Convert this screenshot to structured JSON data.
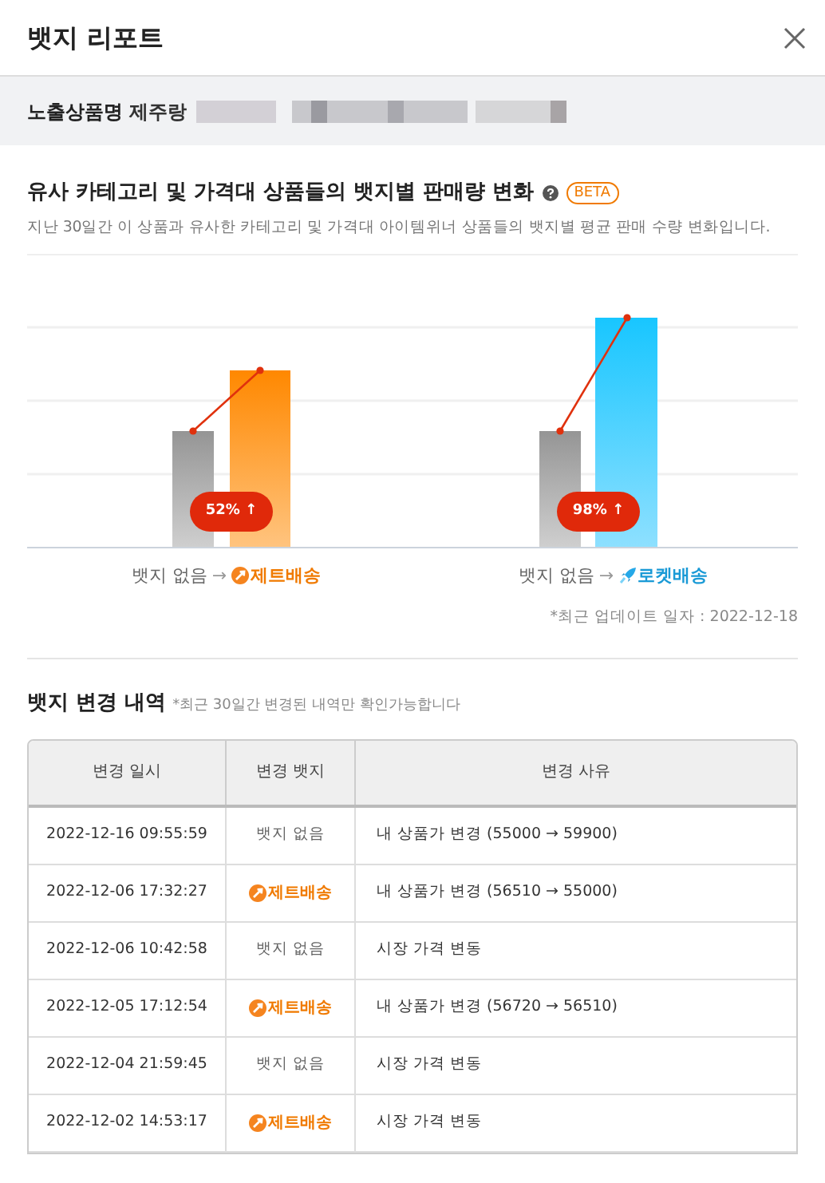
{
  "dialog": {
    "title": "뱃지 리포트"
  },
  "product": {
    "label": "노출상품명",
    "name": "제주랑"
  },
  "sales_change": {
    "title": "유사 카테고리 및 가격대 상품들의 뱃지별 판매량 변화",
    "tag": "BETA",
    "description": "지난 30일간 이 상품과 유사한 카테고리 및 가격대 아이템위너 상품들의 뱃지별 평균 판매 수량 변화입니다.",
    "groups": [
      {
        "from": "뱃지 없음",
        "arrow": "→",
        "badge": {
          "kind": "jet",
          "label": "제트배송"
        },
        "change": "52% ↑"
      },
      {
        "from": "뱃지 없음",
        "arrow": "→",
        "badge": {
          "kind": "rocket",
          "label": "로켓배송"
        },
        "change": "98% ↑"
      }
    ],
    "updated": "*최근 업데이트 일자 : 2022-12-18"
  },
  "history": {
    "title": "뱃지 변경 내역",
    "note": "*최근 30일간 변경된 내역만 확인가능합니다",
    "columns": [
      "변경 일시",
      "변경 뱃지",
      "변경 사유"
    ],
    "rows": [
      {
        "date": "2022-12-16 09:55:59",
        "badge": {
          "kind": "none",
          "label": "뱃지 없음"
        },
        "reason": "내 상품가 변경 (55000 → 59900)"
      },
      {
        "date": "2022-12-06 17:32:27",
        "badge": {
          "kind": "jet",
          "label": "제트배송"
        },
        "reason": "내 상품가 변경 (56510 → 55000)"
      },
      {
        "date": "2022-12-06 10:42:58",
        "badge": {
          "kind": "none",
          "label": "뱃지 없음"
        },
        "reason": "시장 가격 변동"
      },
      {
        "date": "2022-12-05 17:12:54",
        "badge": {
          "kind": "jet",
          "label": "제트배송"
        },
        "reason": "내 상품가 변경 (56720 → 56510)"
      },
      {
        "date": "2022-12-04 21:59:45",
        "badge": {
          "kind": "none",
          "label": "뱃지 없음"
        },
        "reason": "시장 가격 변동"
      },
      {
        "date": "2022-12-02 14:53:17",
        "badge": {
          "kind": "jet",
          "label": "제트배송"
        },
        "reason": "시장 가격 변동"
      }
    ]
  }
}
